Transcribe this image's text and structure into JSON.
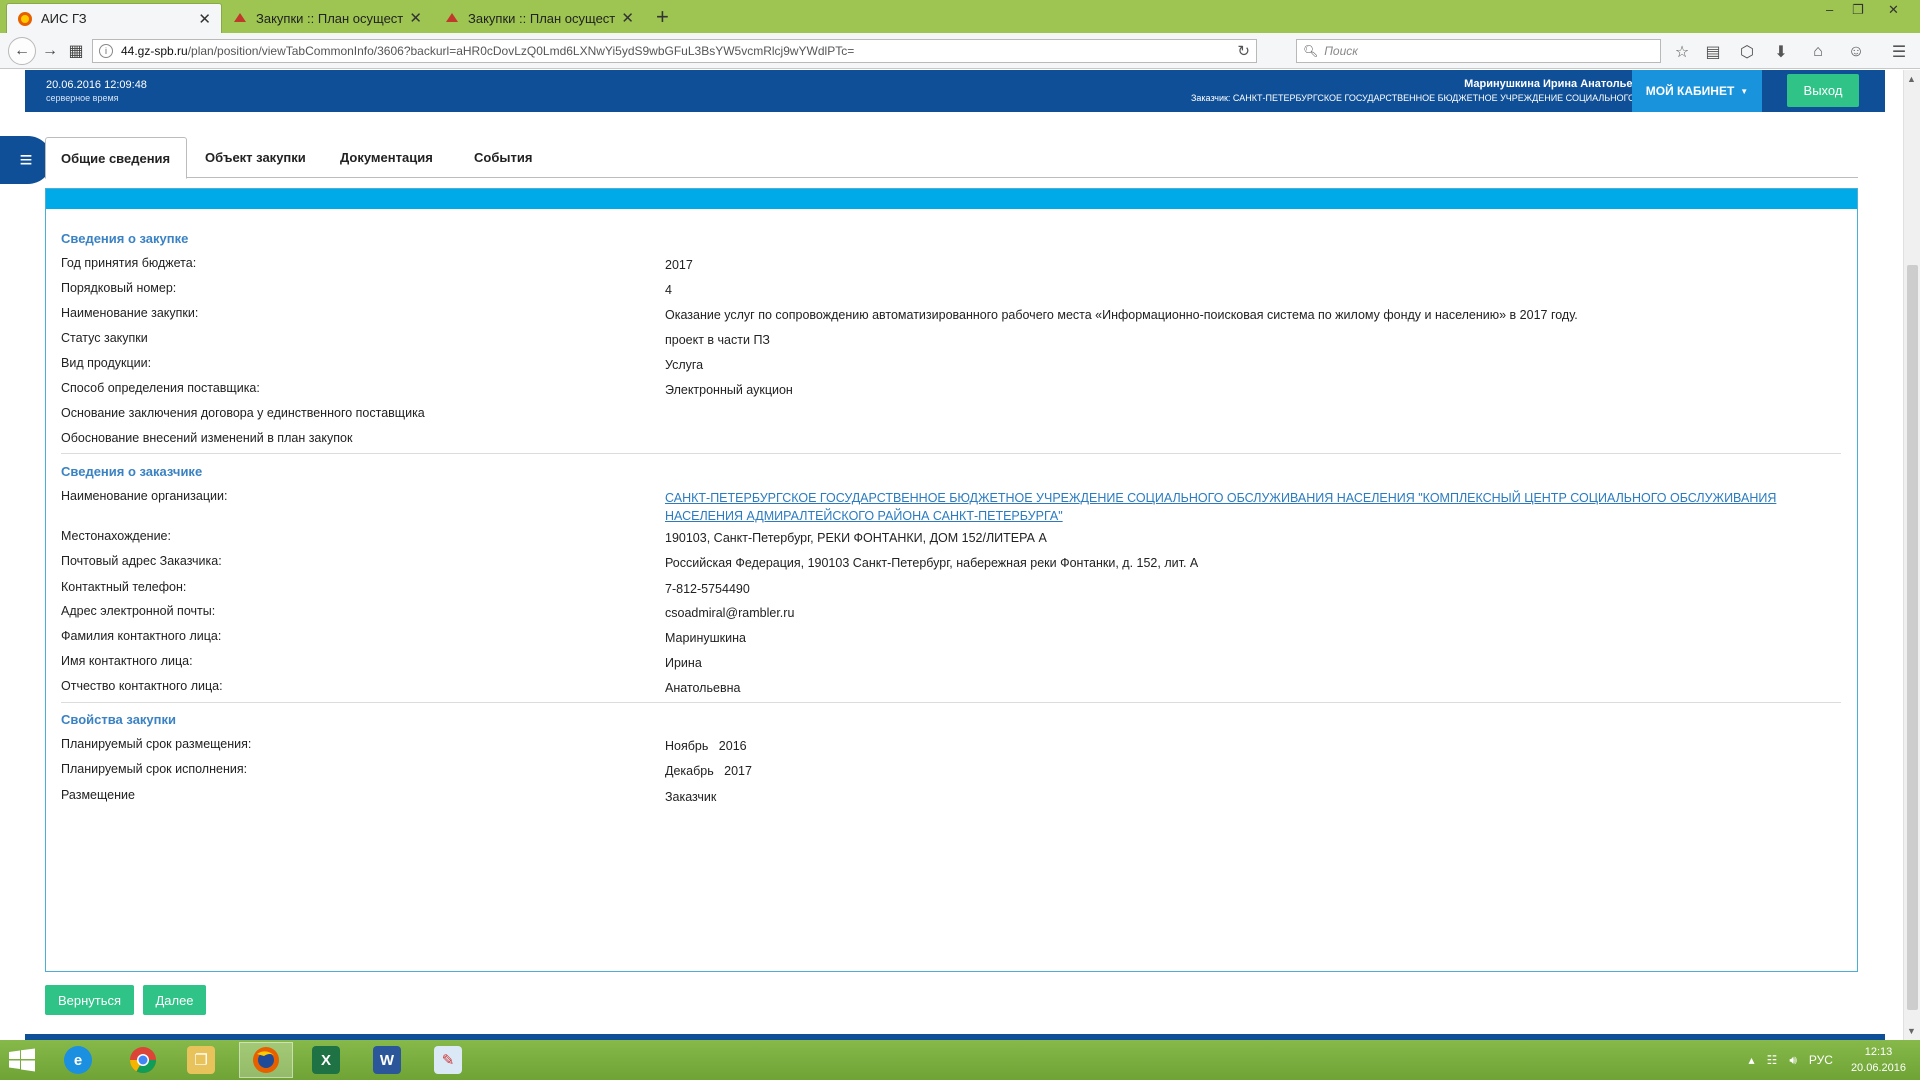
{
  "browser": {
    "tabs": [
      {
        "label": "АИС ГЗ",
        "active": true
      },
      {
        "label": "Закупки :: План осущест...",
        "active": false
      },
      {
        "label": "Закупки :: План осущест...",
        "active": false
      }
    ],
    "url_domain": "44.gz-spb.ru",
    "url_path": "/plan/position/viewTabCommonInfo/3606?backurl=aHR0cDovLzQ0Lmd6LXNwYi5ydS9wbGFuL3BsYW5vcmRlcj9wYWdlPTc=",
    "search_placeholder": "Поиск"
  },
  "header": {
    "datetime": "20.06.2016 12:09:48",
    "datetime_sub": "серверное время",
    "user_name": "Маринушкина Ирина Анатольевна",
    "customer": "Заказчик: САНКТ-ПЕТЕРБУРГСКОЕ ГОСУДАРСТВЕННОЕ БЮДЖЕТНОЕ УЧРЕЖДЕНИЕ СОЦИАЛЬНОГО О...",
    "cabinet_label": "МОЙ КАБИНЕТ",
    "logout_label": "Выход"
  },
  "tabs": [
    {
      "label": "Общие сведения"
    },
    {
      "label": "Объект закупки"
    },
    {
      "label": "Документация"
    },
    {
      "label": "События"
    }
  ],
  "purchase": {
    "title": "Сведения о закупке",
    "rows": [
      {
        "label": "Год принятия бюджета:",
        "value": "2017"
      },
      {
        "label": "Порядковый номер:",
        "value": "4"
      },
      {
        "label": "Наименование закупки:",
        "value": "Оказание услуг по сопровождению автоматизированного рабочего места «Информационно-поисковая система по жилому фонду и населению» в 2017 году."
      },
      {
        "label": "Статус закупки",
        "value": "проект в части ПЗ"
      },
      {
        "label": "Вид продукции:",
        "value": "Услуга"
      },
      {
        "label": "Способ определения поставщика:",
        "value": "Электронный аукцион"
      },
      {
        "label": "Основание заключения договора у единственного поставщика",
        "value": ""
      },
      {
        "label": "Обоснование внесений изменений в план закупок",
        "value": ""
      }
    ]
  },
  "customer": {
    "title": "Сведения о заказчике",
    "org_label": "Наименование организации:",
    "org_value": "САНКТ-ПЕТЕРБУРГСКОЕ ГОСУДАРСТВЕННОЕ БЮДЖЕТНОЕ УЧРЕЖДЕНИЕ СОЦИАЛЬНОГО ОБСЛУЖИВАНИЯ НАСЕЛЕНИЯ \"КОМПЛЕКСНЫЙ ЦЕНТР СОЦИАЛЬНОГО ОБСЛУЖИВАНИЯ НАСЕЛЕНИЯ АДМИРАЛТЕЙСКОГО РАЙОНА САНКТ-ПЕТЕРБУРГА\"",
    "rows": [
      {
        "label": "Местонахождение:",
        "value": "190103, Санкт-Петербург, РЕКИ ФОНТАНКИ, ДОМ 152/ЛИТЕРА А"
      },
      {
        "label": "Почтовый адрес Заказчика:",
        "value": "Российская Федерация, 190103 Санкт-Петербург, набережная реки Фонтанки, д. 152, лит. А"
      },
      {
        "label": "Контактный телефон:",
        "value": "7-812-5754490"
      },
      {
        "label": "Адрес электронной почты:",
        "value": "csoadmiral@rambler.ru"
      },
      {
        "label": "Фамилия контактного лица:",
        "value": "Маринушкина"
      },
      {
        "label": "Имя контактного лица:",
        "value": "Ирина"
      },
      {
        "label": "Отчество контактного лица:",
        "value": "Анатольевна"
      }
    ]
  },
  "properties": {
    "title": "Свойства закупки",
    "rows": [
      {
        "label": "Планируемый срок размещения:",
        "value": "Ноябрь   2016"
      },
      {
        "label": "Планируемый срок исполнения:",
        "value": "Декабрь   2017"
      },
      {
        "label": "Размещение",
        "value": "Заказчик"
      }
    ]
  },
  "buttons": {
    "back": "Вернуться",
    "next": "Далее"
  },
  "taskbar": {
    "lang": "РУС",
    "time": "12:13",
    "date": "20.06.2016"
  }
}
